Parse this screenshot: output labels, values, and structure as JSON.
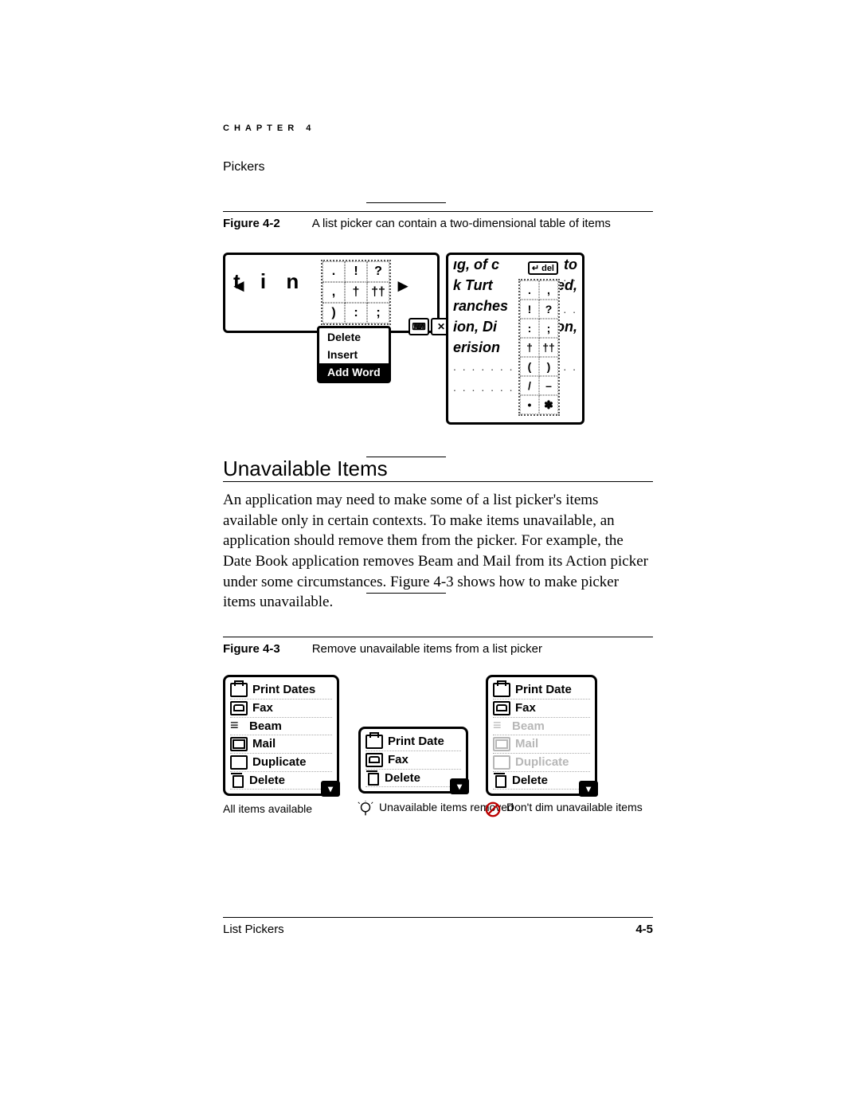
{
  "header": {
    "chapter_mark": "CHAPTER 4",
    "running_head": "Pickers"
  },
  "fig42": {
    "label": "Figure 4-2",
    "caption": "A list picker can contain a two-dimensional table of items",
    "left_panel": {
      "typed_text": "t i n",
      "grid": [
        [
          ".",
          "!",
          "?"
        ],
        [
          ",",
          "†",
          "††"
        ],
        [
          ")",
          ":",
          ";"
        ]
      ],
      "menu": [
        "Delete",
        "Insert",
        "Add Word"
      ],
      "selected_menu_index": 2,
      "toolbar_icons": [
        "keyboard-icon",
        "close-icon"
      ]
    },
    "right_panel": {
      "partial_lines": [
        "ıg, of c",
        "k Turt",
        "ranches",
        "ion, Di",
        "erision"
      ],
      "trailing": [
        "to",
        "ied,",
        "",
        "on,",
        ""
      ],
      "del_button": "del",
      "grid": [
        [
          "↵",
          "del"
        ],
        [
          ".",
          ","
        ],
        [
          "!",
          "?"
        ],
        [
          ":",
          ";"
        ],
        [
          "†",
          "††"
        ],
        [
          "(",
          ")"
        ],
        [
          "/",
          "–"
        ],
        [
          "•",
          "✽"
        ]
      ]
    }
  },
  "section": {
    "heading": "Unavailable Items",
    "body": "An application may need to make some of a list picker's items available only in certain contexts. To make items unavailable, an application should remove them from the picker. For example, the Date Book application removes Beam and Mail from its Action picker under some circumstances. Figure 4-3 shows how to make picker items unavailable."
  },
  "fig43": {
    "label": "Figure 4-3",
    "caption": "Remove unavailable items from a list picker",
    "picker_a": {
      "items": [
        {
          "icon": "printer",
          "label": "Print Dates"
        },
        {
          "icon": "fax",
          "label": "Fax"
        },
        {
          "icon": "beam",
          "label": "Beam"
        },
        {
          "icon": "mail",
          "label": "Mail"
        },
        {
          "icon": "dup",
          "label": "Duplicate"
        },
        {
          "icon": "del",
          "label": "Delete"
        }
      ],
      "annotation": "All items available"
    },
    "picker_b": {
      "items": [
        {
          "icon": "printer",
          "label": "Print Date"
        },
        {
          "icon": "fax",
          "label": "Fax"
        },
        {
          "icon": "del",
          "label": "Delete"
        }
      ],
      "annotation": "Unavailable items removed"
    },
    "picker_c": {
      "items": [
        {
          "icon": "printer",
          "label": "Print Date",
          "dim": false
        },
        {
          "icon": "fax",
          "label": "Fax",
          "dim": false
        },
        {
          "icon": "beam",
          "label": "Beam",
          "dim": true
        },
        {
          "icon": "mail",
          "label": "Mail",
          "dim": true
        },
        {
          "icon": "dup",
          "label": "Duplicate",
          "dim": true
        },
        {
          "icon": "del",
          "label": "Delete",
          "dim": false
        }
      ],
      "annotation": "Don't dim unavailable items"
    }
  },
  "footer": {
    "section": "List Pickers",
    "page": "4-5"
  }
}
